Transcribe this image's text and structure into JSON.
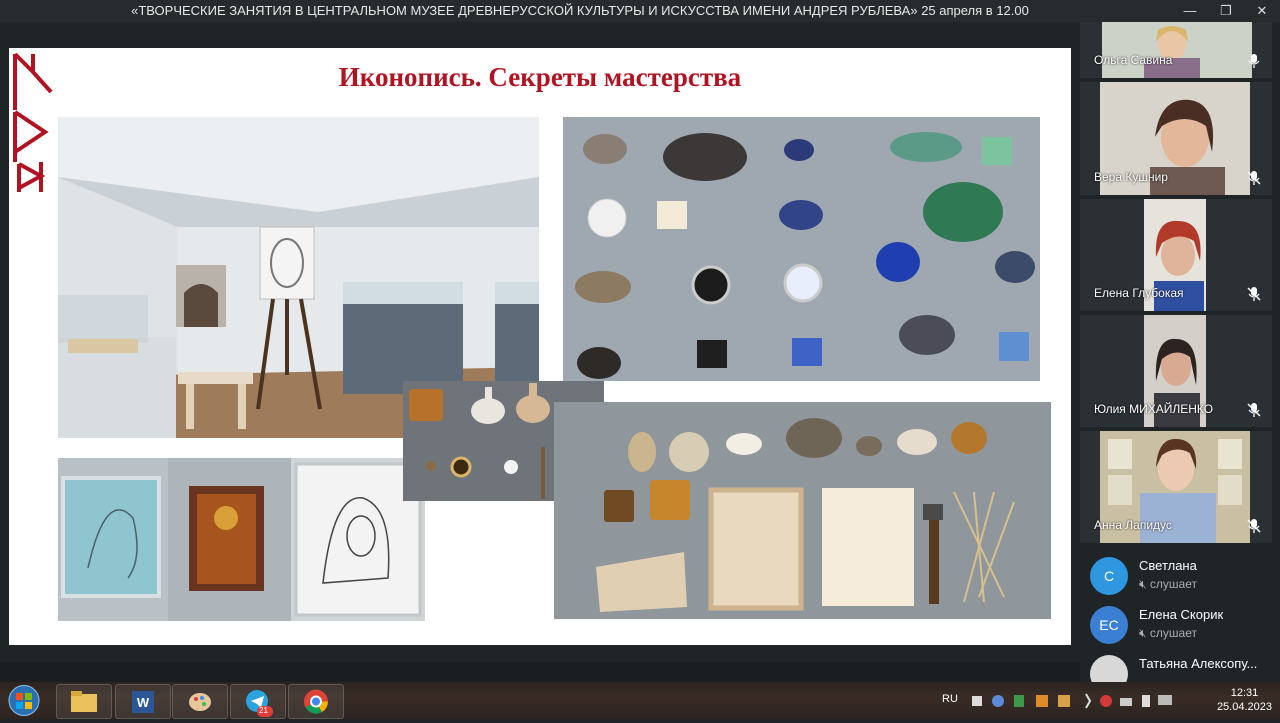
{
  "window": {
    "title": "«ТВОРЧЕСКИЕ ЗАНЯТИЯ В ЦЕНТРАЛЬНОМ МУЗЕЕ ДРЕВНЕРУССКОЙ КУЛЬТУРЫ И ИСКУССТВА ИМЕНИ АНДРЕЯ РУБЛЕВА» 25 апреля в 12.00",
    "minimize_icon": "minimize-icon",
    "restore_icon": "restore-icon",
    "close_icon": "close-icon"
  },
  "slide": {
    "title": "Иконопись. Секреты мастерства",
    "title_color": "#b01422",
    "logo_icon": "museum-logo-icon"
  },
  "participants": [
    {
      "name": "Ольга Савина",
      "mic": "mic-on-icon"
    },
    {
      "name": "Вера Кушнир",
      "mic": "mic-off-icon"
    },
    {
      "name": "Елена Глубокая",
      "mic": "mic-off-icon"
    },
    {
      "name": "Юлия МИХАЙЛЕНКО",
      "mic": "mic-off-icon"
    },
    {
      "name": "Анна Лапидус",
      "mic": "mic-off-icon"
    }
  ],
  "listeners": [
    {
      "initials": "С",
      "name": "Светлана",
      "status": "слушает",
      "avatar_color": "#2f97e0"
    },
    {
      "initials": "ЕС",
      "name": "Елена Скорик",
      "status": "слушает",
      "avatar_color": "#3a7fd4"
    },
    {
      "initials": "",
      "name": "Татьяна Алексопу...",
      "status": "",
      "avatar_color": "#cccccc"
    }
  ],
  "taskbar": {
    "apps": [
      "start-orb-icon",
      "file-explorer-icon",
      "word-icon",
      "paint-icon",
      "telegram-icon",
      "chrome-icon"
    ],
    "telegram_badge": "21",
    "language": "RU",
    "time": "12:31",
    "date": "25.04.2023"
  }
}
